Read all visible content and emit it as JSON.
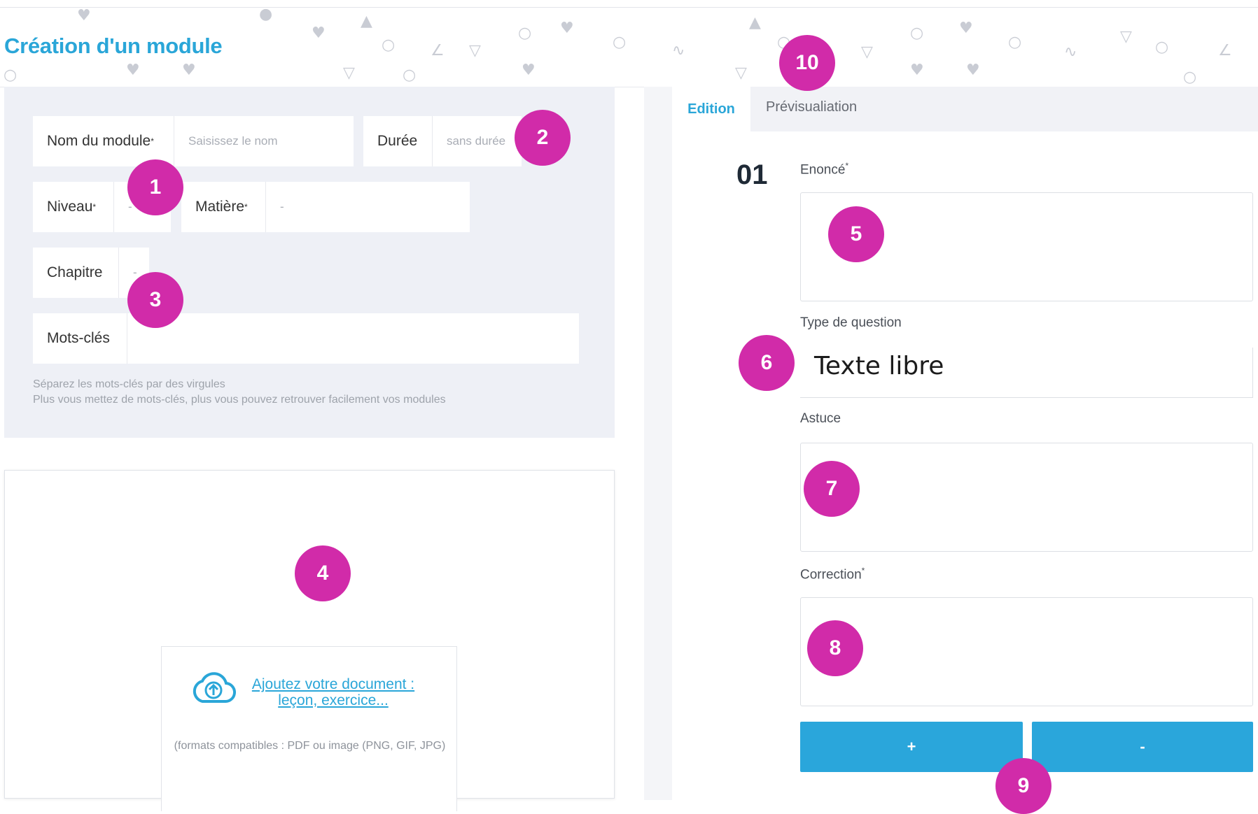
{
  "header": {
    "title": "Création d'un module"
  },
  "form": {
    "module_name_label": "Nom du module",
    "module_name_placeholder": "Saisissez le nom",
    "duration_label": "Durée",
    "duration_value": "sans durée",
    "level_label": "Niveau",
    "level_value": "-",
    "subject_label": "Matière",
    "subject_value": "-",
    "chapter_label": "Chapitre",
    "chapter_value": "-",
    "keywords_label": "Mots-clés",
    "keywords_hint_1": "Séparez les mots-clés par des virgules",
    "keywords_hint_2": "Plus vous mettez de mots-clés, plus vous pouvez retrouver facilement vos modules",
    "required_mark": "*"
  },
  "upload": {
    "link_text": "Ajoutez votre document : leçon, exercice...",
    "formats_text": "(formats compatibles : PDF ou image (PNG, GIF, JPG)"
  },
  "tabs": {
    "edition": "Edition",
    "preview": "Prévisualiation"
  },
  "question": {
    "number": "01",
    "statement_label": "Enoncé",
    "type_label": "Type de question",
    "type_value": "Texte libre",
    "hint_label": "Astuce",
    "correction_label": "Correction",
    "add_button": "+",
    "remove_button": "-"
  },
  "callouts": [
    "1",
    "2",
    "3",
    "4",
    "5",
    "6",
    "7",
    "8",
    "9",
    "10"
  ],
  "colors": {
    "accent": "#2aa6d8",
    "callout": "#d12ba9",
    "panel": "#eef0f6"
  }
}
